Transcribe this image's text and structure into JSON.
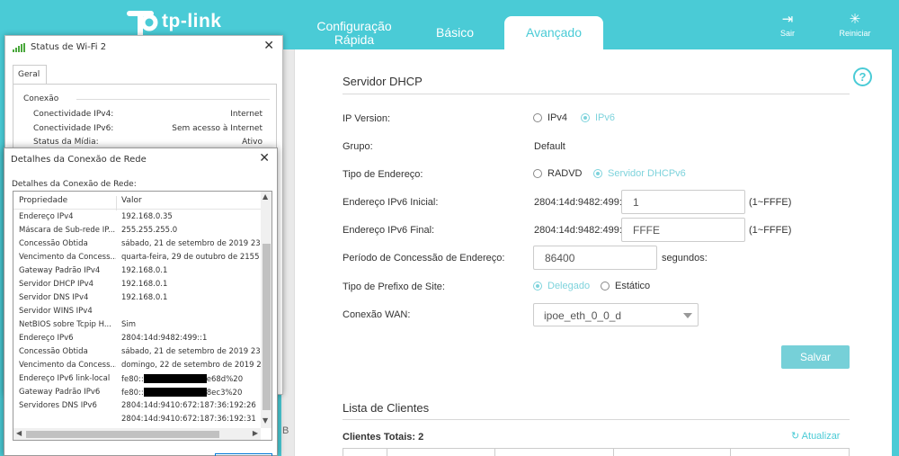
{
  "brand": {
    "name": "tp-link",
    "accent": "#4acbd6"
  },
  "header": {
    "tabs": [
      {
        "label_line1": "Configuração",
        "label_line2": "Rápida"
      },
      {
        "label": "Básico"
      },
      {
        "label": "Avançado"
      }
    ],
    "exit_label": "Sair",
    "reboot_label": "Reiniciar"
  },
  "dhcp": {
    "title": "Servidor DHCP",
    "help": "?",
    "ip_version_label": "IP Version:",
    "ipv4": "IPv4",
    "ipv6": "IPv6",
    "group_label": "Grupo:",
    "group_value": "Default",
    "addr_type_label": "Tipo de Endereço:",
    "radvd": "RADVD",
    "dhcpv6": "Servidor DHCPv6",
    "start_label": "Endereço IPv6 Inicial:",
    "start_prefix": "2804:14d:9482:499::",
    "start_value": "1",
    "start_range": "(1~FFFE)",
    "end_label": "Endereço IPv6 Final:",
    "end_prefix": "2804:14d:9482:499::",
    "end_value": "FFFE",
    "end_range": "(1~FFFE)",
    "lease_label": "Período de Concessão de Endereço:",
    "lease_value": "86400",
    "lease_unit": "segundos:",
    "prefix_label": "Tipo de Prefixo de Site:",
    "delegated": "Delegado",
    "static": "Estático",
    "wan_label": "Conexão WAN:",
    "wan_value": "ipoe_eth_0_0_d",
    "save": "Salvar"
  },
  "clients": {
    "title": "Lista de Clientes",
    "total": "Clientes Totais: 2",
    "refresh": "Atualizar"
  },
  "behind_letter": "B",
  "wifi_status": {
    "title": "Status de Wi-Fi 2",
    "tab": "Geral",
    "group": "Conexão",
    "rows": [
      {
        "label": "Conectividade IPv4:",
        "value": "Internet"
      },
      {
        "label": "Conectividade IPv6:",
        "value": "Sem acesso à Internet"
      },
      {
        "label": "Status da Mídia:",
        "value": "Ativo"
      }
    ]
  },
  "details": {
    "title": "Detalhes da Conexão de Rede",
    "subtitle": "Detalhes da Conexão de Rede:",
    "col_property": "Propriedade",
    "col_value": "Valor",
    "rows": [
      {
        "p": "Endereço IPv4",
        "v": "192.168.0.35"
      },
      {
        "p": "Máscara de Sub-rede IP...",
        "v": "255.255.255.0"
      },
      {
        "p": "Concessão Obtida",
        "v": "sábado, 21 de setembro de 2019 23:2"
      },
      {
        "p": "Vencimento da Concess...",
        "v": "quarta-feira, 29 de outubro de 2155 0!"
      },
      {
        "p": "Gateway Padrão IPv4",
        "v": "192.168.0.1"
      },
      {
        "p": "Servidor DHCP IPv4",
        "v": "192.168.0.1"
      },
      {
        "p": "Servidor DNS IPv4",
        "v": "192.168.0.1"
      },
      {
        "p": "Servidor WINS IPv4",
        "v": ""
      },
      {
        "p": "NetBIOS sobre Tcpip H...",
        "v": "Sim"
      },
      {
        "p": "Endereço IPv6",
        "v": "2804:14d:9482:499::1"
      },
      {
        "p": "Concessão Obtida",
        "v": "sábado, 21 de setembro de 2019 23:2"
      },
      {
        "p": "Vencimento da Concess...",
        "v": "domingo, 22 de setembro de 2019 23:"
      },
      {
        "p": "Endereço IPv6 link-local",
        "v_pre": "fe80::",
        "v_post": "e68d%20"
      },
      {
        "p": "Gateway Padrão IPv6",
        "v_pre": "fe80::",
        "v_post": "8ec3%20"
      },
      {
        "p": "Servidores DNS IPv6",
        "v": "2804:14d:9410:672:187:36:192:26"
      },
      {
        "p": "",
        "v": "2804:14d:9410:672:187:36:192:31"
      }
    ]
  }
}
